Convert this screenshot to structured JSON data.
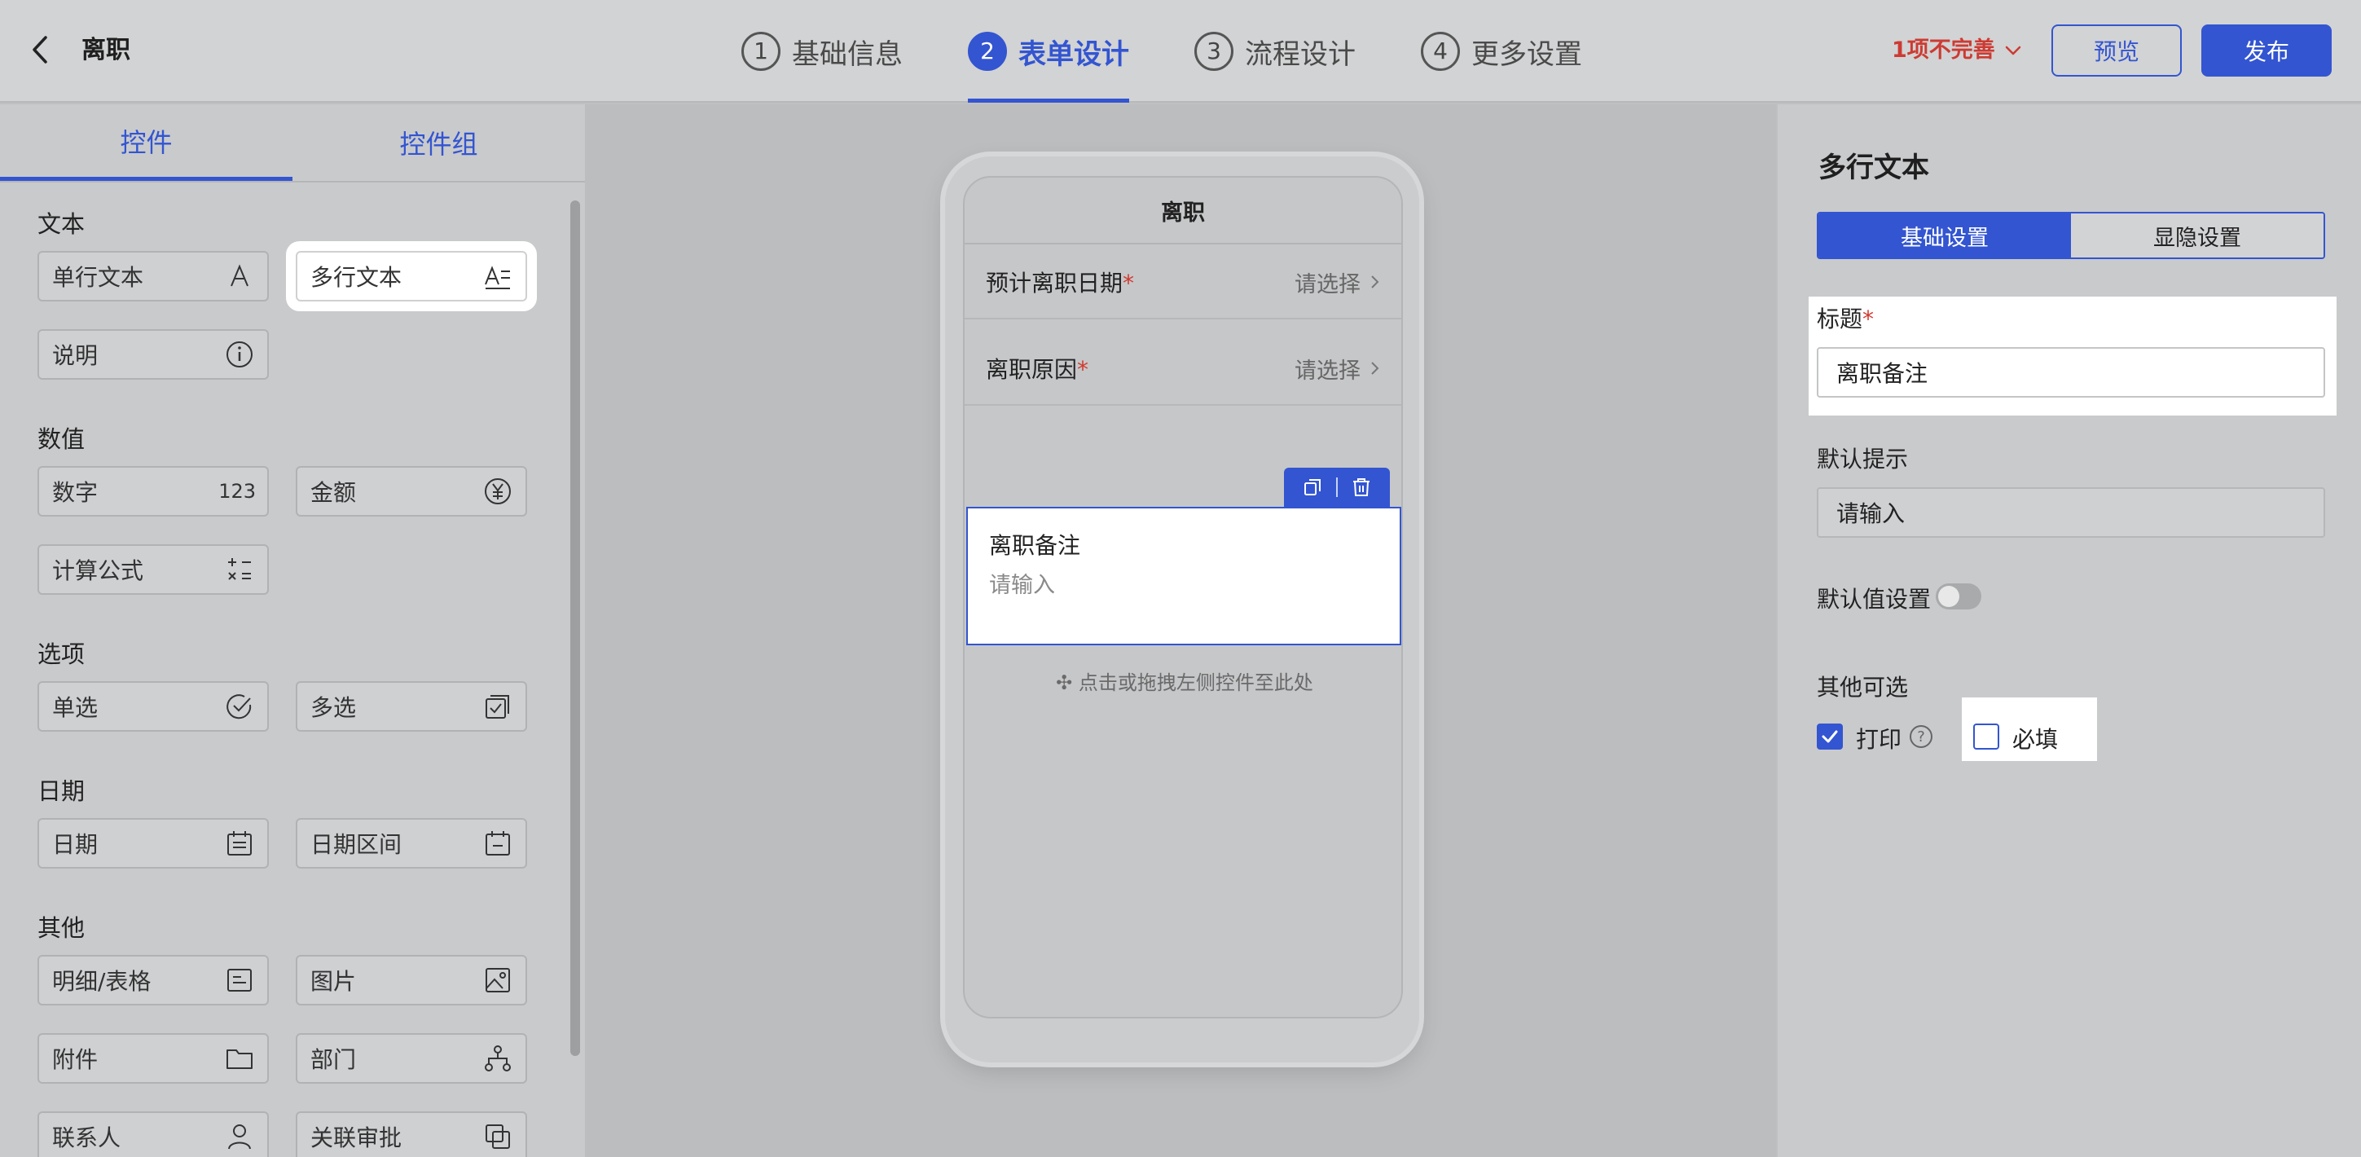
{
  "header": {
    "title": "离职",
    "steps": [
      {
        "num": "1",
        "label": "基础信息",
        "active": false
      },
      {
        "num": "2",
        "label": "表单设计",
        "active": true
      },
      {
        "num": "3",
        "label": "流程设计",
        "active": false
      },
      {
        "num": "4",
        "label": "更多设置",
        "active": false
      }
    ],
    "incomplete_text": "1项不完善",
    "preview_label": "预览",
    "publish_label": "发布"
  },
  "left_panel": {
    "tabs": [
      "控件",
      "控件组"
    ],
    "sections": {
      "text": "文本",
      "number": "数值",
      "options": "选项",
      "date": "日期",
      "other": "其他"
    },
    "controls": {
      "single_text": "单行文本",
      "multi_text": "多行文本",
      "description": "说明",
      "number": "数字",
      "number_icon": "123",
      "amount": "金额",
      "formula": "计算公式",
      "single_choice": "单选",
      "multi_choice": "多选",
      "date": "日期",
      "date_range": "日期区间",
      "detail_table": "明细/表格",
      "image": "图片",
      "attachment": "附件",
      "department": "部门",
      "contact": "联系人",
      "related_approval": "关联审批"
    }
  },
  "phone": {
    "title": "离职",
    "fields": [
      {
        "label": "预计离职日期",
        "required": "*",
        "value": "请选择"
      },
      {
        "label": "离职原因",
        "required": "*",
        "value": "请选择"
      }
    ],
    "selected_field": {
      "label": "离职备注",
      "placeholder": "请输入"
    },
    "drop_hint": "点击或拖拽左侧控件至此处"
  },
  "right_panel": {
    "title": "多行文本",
    "tabs": [
      "基础设置",
      "显隐设置"
    ],
    "title_label": "标题",
    "title_required": "*",
    "title_value": "离职备注",
    "default_hint_label": "默认提示",
    "default_hint_value": "请输入",
    "default_value_label": "默认值设置",
    "default_value_enabled": false,
    "other_options_label": "其他可选",
    "print_label": "打印",
    "print_checked": true,
    "required_label": "必填",
    "required_checked": false
  },
  "colors": {
    "accent": "#3355d1",
    "warning": "#cc3b33"
  }
}
